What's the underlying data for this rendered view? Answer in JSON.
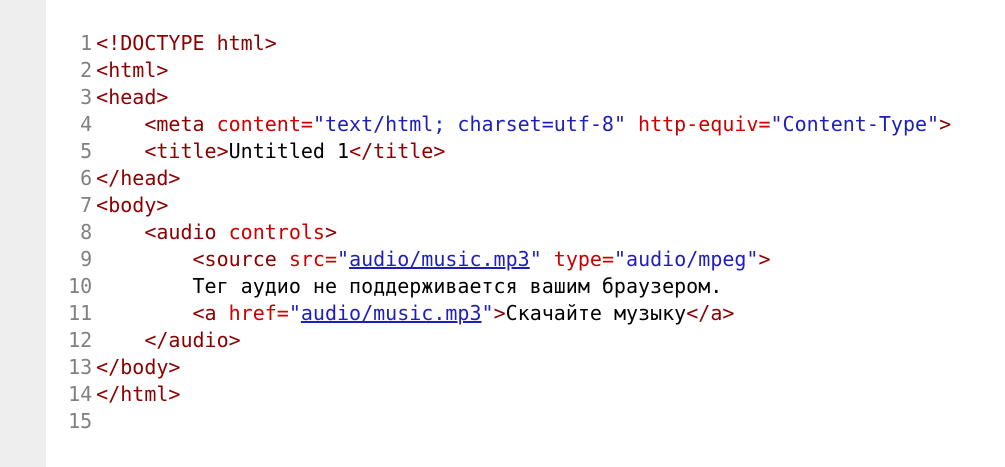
{
  "editor": {
    "lines": [
      {
        "num": "1"
      },
      {
        "num": "2"
      },
      {
        "num": "3"
      },
      {
        "num": "4"
      },
      {
        "num": "5"
      },
      {
        "num": "6"
      },
      {
        "num": "7"
      },
      {
        "num": "8"
      },
      {
        "num": "9"
      },
      {
        "num": "10"
      },
      {
        "num": "11"
      },
      {
        "num": "12"
      },
      {
        "num": "13"
      },
      {
        "num": "14"
      },
      {
        "num": "15"
      }
    ]
  },
  "code": {
    "l1": {
      "doctype": "<!DOCTYPE html>"
    },
    "l2": {
      "open": "<html>"
    },
    "l3": {
      "open": "<head>"
    },
    "l4": {
      "indent": "    ",
      "tag_open": "<meta",
      "attr1": " content=",
      "val1": "\"text/html; charset=utf-8\"",
      "attr2": " http-equiv=",
      "val2": "\"Content-Type\"",
      "tag_close": ">"
    },
    "l5": {
      "indent": "    ",
      "open": "<title>",
      "text": "Untitled 1",
      "close": "</title>"
    },
    "l6": {
      "close": "</head>"
    },
    "l7": {
      "open": "<body>"
    },
    "l8": {
      "indent": "    ",
      "tag_open": "<audio",
      "attr": " controls",
      "tag_close": ">"
    },
    "l9": {
      "indent": "        ",
      "tag_open": "<source",
      "attr1": " src=",
      "q1": "\"",
      "src": "audio/music.mp3",
      "q2": "\"",
      "attr2": " type=",
      "val2": "\"audio/mpeg\"",
      "tag_close": ">"
    },
    "l10": {
      "indent": "        ",
      "text": "Тег аудио не поддерживается вашим браузером."
    },
    "l11": {
      "indent": "        ",
      "tag_open": "<a",
      "attr": " href=",
      "q1": "\"",
      "href": "audio/music.mp3",
      "q2": "\"",
      "tag_close": ">",
      "text": "Скачайте музыку",
      "close": "</a>"
    },
    "l12": {
      "indent": "    ",
      "close": "</audio>"
    },
    "l13": {
      "close": "</body>"
    },
    "l14": {
      "close": "</html>"
    }
  },
  "colors": {
    "tag": "#8b0000",
    "attribute": "#cc0000",
    "value": "#1e1ebd",
    "text": "#000000",
    "line_number": "#808080",
    "gutter_background": "#eeeeee"
  }
}
